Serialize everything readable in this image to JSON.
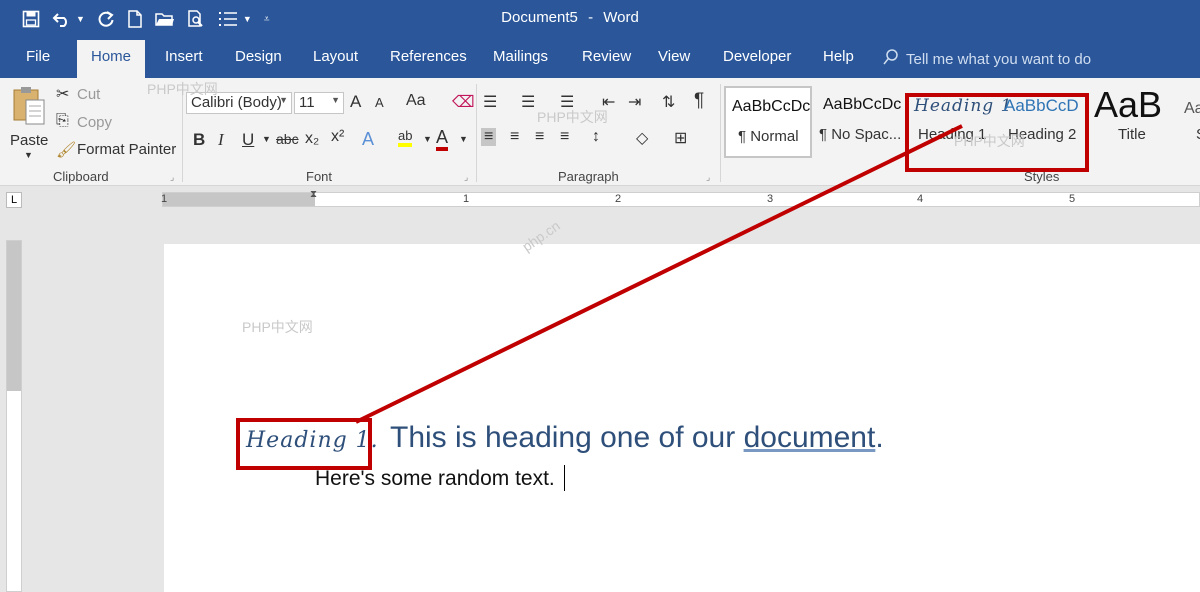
{
  "titlebar": {
    "document_title": "Document5",
    "separator": "-",
    "app_name": "Word"
  },
  "tabs": [
    {
      "label": "File"
    },
    {
      "label": "Home"
    },
    {
      "label": "Insert"
    },
    {
      "label": "Design"
    },
    {
      "label": "Layout"
    },
    {
      "label": "References"
    },
    {
      "label": "Mailings"
    },
    {
      "label": "Review"
    },
    {
      "label": "View"
    },
    {
      "label": "Developer"
    },
    {
      "label": "Help"
    }
  ],
  "tell_me": {
    "placeholder": "Tell me what you want to do"
  },
  "clipboard": {
    "paste": "Paste",
    "cut": "Cut",
    "copy": "Copy",
    "format_painter": "Format Painter",
    "group_label": "Clipboard"
  },
  "font": {
    "family": "Calibri (Body)",
    "size": "11",
    "bold": "B",
    "italic": "I",
    "underline": "U",
    "strike": "abc",
    "subscript": "x₂",
    "superscript": "x²",
    "grow": "A",
    "shrink": "A",
    "change_case": "Aa",
    "effects": "A",
    "highlight": "ab",
    "color": "A",
    "group_label": "Font"
  },
  "paragraph": {
    "group_label": "Paragraph",
    "pilcrow": "¶"
  },
  "styles": {
    "items": [
      {
        "sample": "AaBbCcDc",
        "name": "¶ Normal"
      },
      {
        "sample": "AaBbCcDc",
        "name": "¶ No Spac..."
      },
      {
        "sample": "Heading 1",
        "name": "Heading 1"
      },
      {
        "sample": "AaBbCcD",
        "name": "Heading 2"
      },
      {
        "sample": "AaB",
        "name": "Title"
      },
      {
        "sample": "Aa",
        "name": "S"
      }
    ],
    "group_label": "Styles"
  },
  "ruler": {
    "tab_selector": "L",
    "numbers": [
      "1",
      "1",
      "2",
      "3",
      "4",
      "5"
    ]
  },
  "document": {
    "heading_label": "Heading 1.",
    "heading_text_before": "This is heading one of our",
    "heading_text_link": "document",
    "heading_text_after": ".",
    "body_text": "Here's some random text."
  },
  "watermarks": [
    "PHP中文网",
    "PHP中文网",
    "PHP中文网",
    "PHP中文网",
    "php.cn"
  ],
  "colors": {
    "title_bar": "#2b579a",
    "ribbon": "#f3f3f3",
    "annotation_red": "#c00000",
    "heading_blue": "#2e4f7a"
  }
}
